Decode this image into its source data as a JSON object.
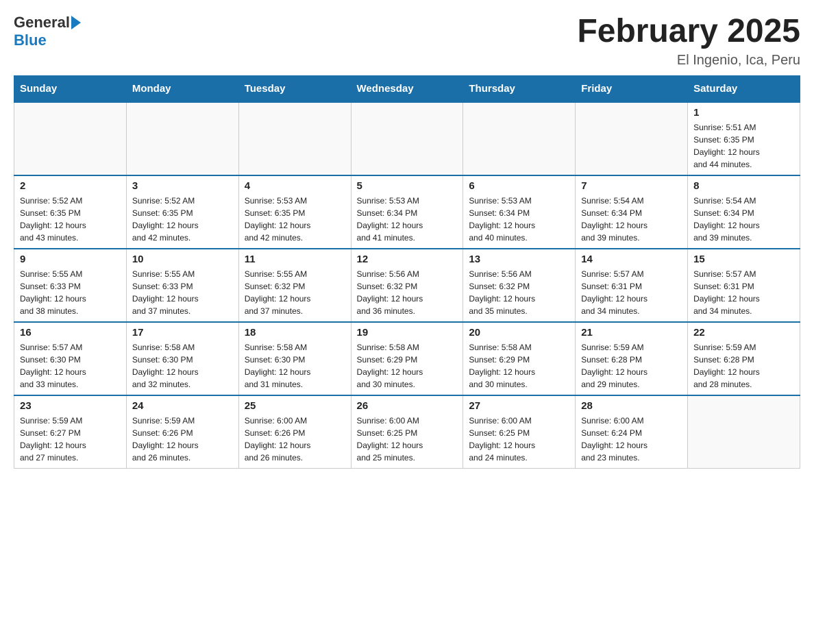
{
  "header": {
    "logo": {
      "text_general": "General",
      "text_blue": "Blue"
    },
    "title": "February 2025",
    "location": "El Ingenio, Ica, Peru"
  },
  "weekdays": [
    "Sunday",
    "Monday",
    "Tuesday",
    "Wednesday",
    "Thursday",
    "Friday",
    "Saturday"
  ],
  "weeks": [
    [
      {
        "day": "",
        "info": ""
      },
      {
        "day": "",
        "info": ""
      },
      {
        "day": "",
        "info": ""
      },
      {
        "day": "",
        "info": ""
      },
      {
        "day": "",
        "info": ""
      },
      {
        "day": "",
        "info": ""
      },
      {
        "day": "1",
        "info": "Sunrise: 5:51 AM\nSunset: 6:35 PM\nDaylight: 12 hours\nand 44 minutes."
      }
    ],
    [
      {
        "day": "2",
        "info": "Sunrise: 5:52 AM\nSunset: 6:35 PM\nDaylight: 12 hours\nand 43 minutes."
      },
      {
        "day": "3",
        "info": "Sunrise: 5:52 AM\nSunset: 6:35 PM\nDaylight: 12 hours\nand 42 minutes."
      },
      {
        "day": "4",
        "info": "Sunrise: 5:53 AM\nSunset: 6:35 PM\nDaylight: 12 hours\nand 42 minutes."
      },
      {
        "day": "5",
        "info": "Sunrise: 5:53 AM\nSunset: 6:34 PM\nDaylight: 12 hours\nand 41 minutes."
      },
      {
        "day": "6",
        "info": "Sunrise: 5:53 AM\nSunset: 6:34 PM\nDaylight: 12 hours\nand 40 minutes."
      },
      {
        "day": "7",
        "info": "Sunrise: 5:54 AM\nSunset: 6:34 PM\nDaylight: 12 hours\nand 39 minutes."
      },
      {
        "day": "8",
        "info": "Sunrise: 5:54 AM\nSunset: 6:34 PM\nDaylight: 12 hours\nand 39 minutes."
      }
    ],
    [
      {
        "day": "9",
        "info": "Sunrise: 5:55 AM\nSunset: 6:33 PM\nDaylight: 12 hours\nand 38 minutes."
      },
      {
        "day": "10",
        "info": "Sunrise: 5:55 AM\nSunset: 6:33 PM\nDaylight: 12 hours\nand 37 minutes."
      },
      {
        "day": "11",
        "info": "Sunrise: 5:55 AM\nSunset: 6:32 PM\nDaylight: 12 hours\nand 37 minutes."
      },
      {
        "day": "12",
        "info": "Sunrise: 5:56 AM\nSunset: 6:32 PM\nDaylight: 12 hours\nand 36 minutes."
      },
      {
        "day": "13",
        "info": "Sunrise: 5:56 AM\nSunset: 6:32 PM\nDaylight: 12 hours\nand 35 minutes."
      },
      {
        "day": "14",
        "info": "Sunrise: 5:57 AM\nSunset: 6:31 PM\nDaylight: 12 hours\nand 34 minutes."
      },
      {
        "day": "15",
        "info": "Sunrise: 5:57 AM\nSunset: 6:31 PM\nDaylight: 12 hours\nand 34 minutes."
      }
    ],
    [
      {
        "day": "16",
        "info": "Sunrise: 5:57 AM\nSunset: 6:30 PM\nDaylight: 12 hours\nand 33 minutes."
      },
      {
        "day": "17",
        "info": "Sunrise: 5:58 AM\nSunset: 6:30 PM\nDaylight: 12 hours\nand 32 minutes."
      },
      {
        "day": "18",
        "info": "Sunrise: 5:58 AM\nSunset: 6:30 PM\nDaylight: 12 hours\nand 31 minutes."
      },
      {
        "day": "19",
        "info": "Sunrise: 5:58 AM\nSunset: 6:29 PM\nDaylight: 12 hours\nand 30 minutes."
      },
      {
        "day": "20",
        "info": "Sunrise: 5:58 AM\nSunset: 6:29 PM\nDaylight: 12 hours\nand 30 minutes."
      },
      {
        "day": "21",
        "info": "Sunrise: 5:59 AM\nSunset: 6:28 PM\nDaylight: 12 hours\nand 29 minutes."
      },
      {
        "day": "22",
        "info": "Sunrise: 5:59 AM\nSunset: 6:28 PM\nDaylight: 12 hours\nand 28 minutes."
      }
    ],
    [
      {
        "day": "23",
        "info": "Sunrise: 5:59 AM\nSunset: 6:27 PM\nDaylight: 12 hours\nand 27 minutes."
      },
      {
        "day": "24",
        "info": "Sunrise: 5:59 AM\nSunset: 6:26 PM\nDaylight: 12 hours\nand 26 minutes."
      },
      {
        "day": "25",
        "info": "Sunrise: 6:00 AM\nSunset: 6:26 PM\nDaylight: 12 hours\nand 26 minutes."
      },
      {
        "day": "26",
        "info": "Sunrise: 6:00 AM\nSunset: 6:25 PM\nDaylight: 12 hours\nand 25 minutes."
      },
      {
        "day": "27",
        "info": "Sunrise: 6:00 AM\nSunset: 6:25 PM\nDaylight: 12 hours\nand 24 minutes."
      },
      {
        "day": "28",
        "info": "Sunrise: 6:00 AM\nSunset: 6:24 PM\nDaylight: 12 hours\nand 23 minutes."
      },
      {
        "day": "",
        "info": ""
      }
    ]
  ]
}
